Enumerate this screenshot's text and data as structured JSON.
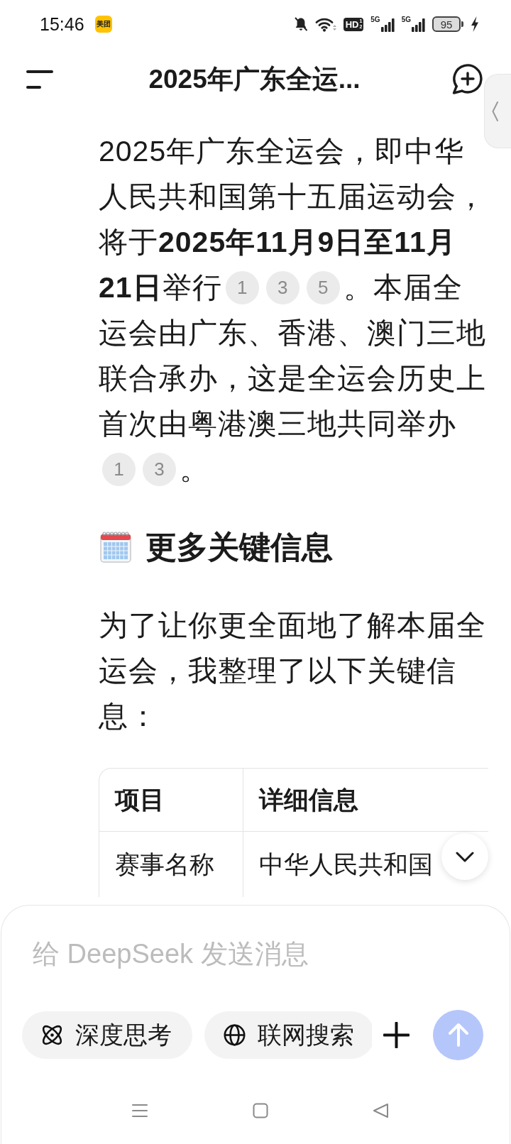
{
  "status_bar": {
    "time": "15:46",
    "notification_icons": [
      {
        "label": "美团"
      }
    ],
    "muted": true,
    "hd_badge": {
      "label": "HD",
      "superscript": "1",
      "subscript": "2"
    },
    "signals": [
      {
        "label": "5G"
      },
      {
        "label": "5G"
      }
    ],
    "battery": {
      "label": "95",
      "charging": true
    }
  },
  "header": {
    "title": "2025年广东全运..."
  },
  "message": {
    "blocks": [
      {
        "kind": "paragraph",
        "segments": [
          {
            "kind": "text",
            "text": "2025年广东全运会，即中华人民共和国第十五届运动会，将于**2025年11月9日至11月21日**举行"
          },
          {
            "kind": "citation",
            "text": "1"
          },
          {
            "kind": "citation",
            "text": "3"
          },
          {
            "kind": "citation",
            "text": "5"
          },
          {
            "kind": "text",
            "text": "。本届全运会由广东、香港、澳门三地联合承办，这是全运会历史上首次由粤港澳三地共同举办"
          },
          {
            "kind": "citation",
            "text": "1"
          },
          {
            "kind": "citation",
            "text": "3"
          },
          {
            "kind": "text",
            "text": "。"
          }
        ]
      },
      {
        "kind": "heading",
        "text": "更多关键信息"
      },
      {
        "kind": "paragraph",
        "segments": [
          {
            "kind": "text",
            "text": "为了让你更全面地了解本届全运会，我整理了以下关键信息："
          }
        ]
      },
      {
        "kind": "table",
        "columns": [
          "项目",
          "详细信息"
        ],
        "rows": [
          [
            "赛事名称",
            "中华人民共和国"
          ]
        ]
      }
    ]
  },
  "composer": {
    "placeholder": "给 DeepSeek 发送消息",
    "toggles": [
      {
        "kind": "reasoning",
        "label": "深度思考",
        "selected": false
      },
      {
        "kind": "search",
        "label": "联网搜索",
        "selected": false
      }
    ],
    "send": {
      "disabled": true
    }
  }
}
